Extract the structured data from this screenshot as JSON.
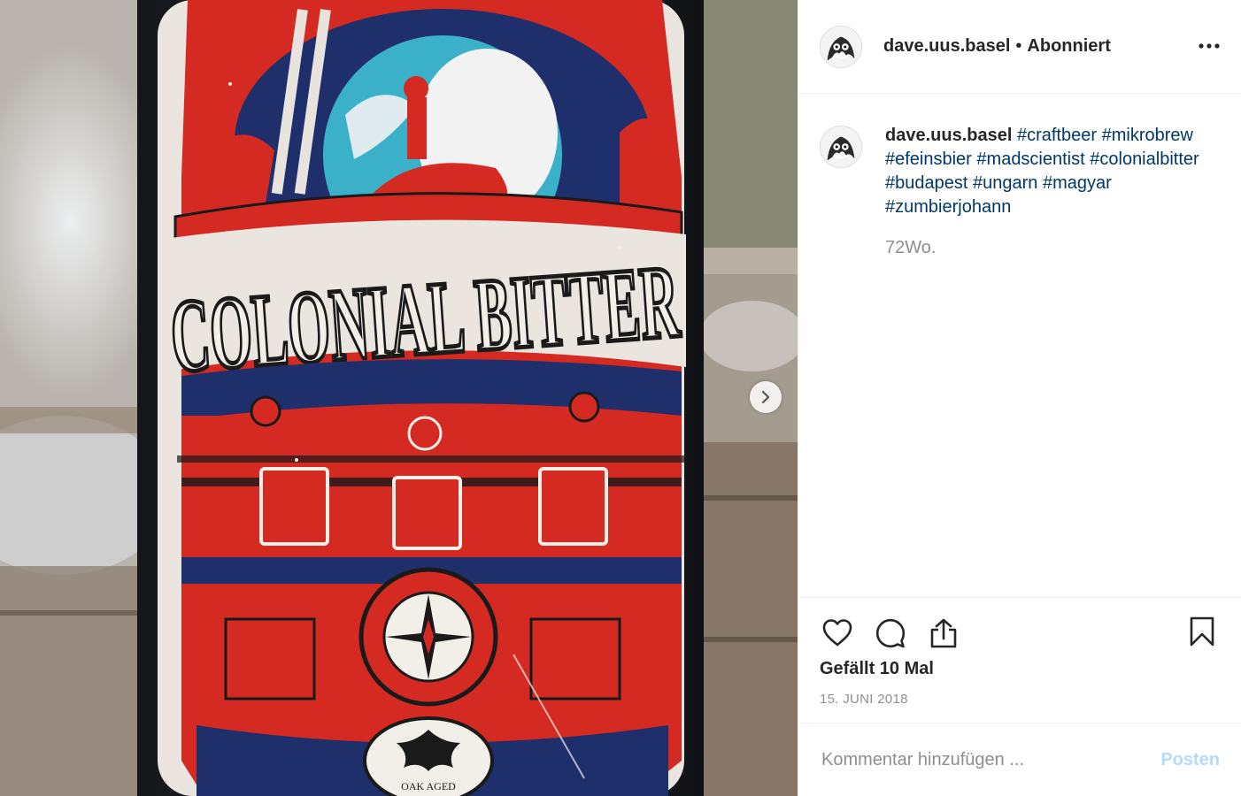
{
  "post": {
    "image_alt": "Colonial Bitter beer bottle label",
    "label_text": "COLONIAL BITTER",
    "badge_text": "OAK AGED",
    "next_icon": "chevron-right-icon"
  },
  "header": {
    "username": "dave.uus.basel",
    "separator": "•",
    "follow_status": "Abonniert",
    "more_icon": "more-horizontal-icon"
  },
  "caption": {
    "username": "dave.uus.basel",
    "hashtags": [
      "#craftbeer",
      "#mikrobrew",
      "#efeinsbier",
      "#madscientist",
      "#colonialbitter",
      "#budapest",
      "#ungarn",
      "#magyar",
      "#zumbierjohann"
    ],
    "age": "72Wo."
  },
  "actions": {
    "like_icon": "heart-icon",
    "comment_icon": "comment-icon",
    "share_icon": "share-icon",
    "save_icon": "bookmark-icon",
    "likes_text": "Gefällt 10 Mal",
    "date": "15. JUNI 2018"
  },
  "comment_box": {
    "placeholder": "Kommentar hinzufügen ...",
    "post_label": "Posten"
  },
  "colors": {
    "hashtag": "#00376b",
    "muted": "#8e8e8e",
    "post_button": "#b3dbff",
    "label_red": "#d42a22",
    "label_navy": "#1f2f6b"
  }
}
